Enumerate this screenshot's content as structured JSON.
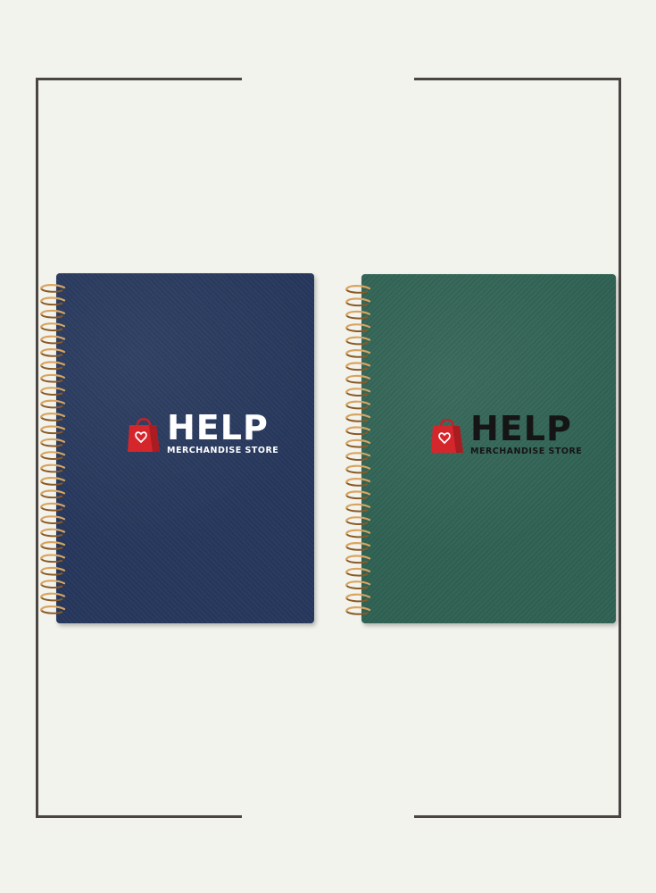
{
  "image": {
    "background_color": "#f3f3ee",
    "frame_color": "#4a4542"
  },
  "notebooks": [
    {
      "cover_color": "#26375c",
      "binding": "gold-spiral",
      "logo": {
        "icon": "shopping-bag-heart-icon",
        "title": "HELP",
        "subtitle": "MERCHANDISE STORE",
        "text_color": "#ffffff"
      }
    },
    {
      "cover_color": "#2f6253",
      "binding": "gold-spiral",
      "logo": {
        "icon": "shopping-bag-heart-icon",
        "title": "HELP",
        "subtitle": "MERCHANDISE STORE",
        "text_color": "#151515"
      }
    }
  ]
}
